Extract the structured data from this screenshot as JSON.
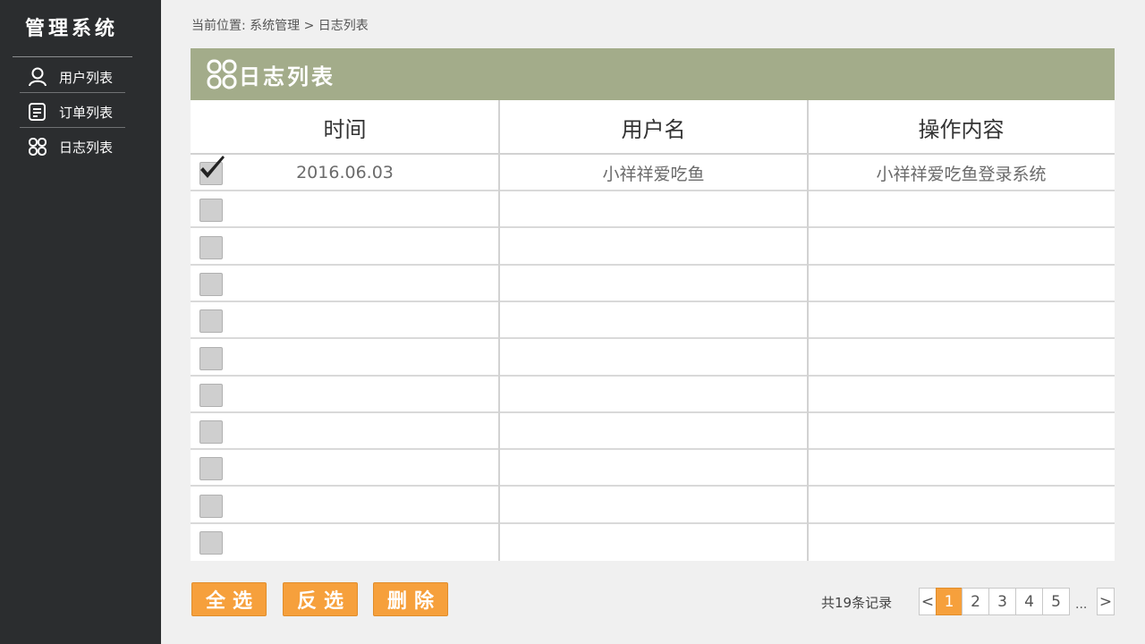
{
  "app": {
    "title": "管理系统"
  },
  "sidebar": {
    "items": [
      {
        "label": "用户列表",
        "icon": "user-icon"
      },
      {
        "label": "订单列表",
        "icon": "order-list-icon"
      },
      {
        "label": "日志列表",
        "icon": "grid-icon"
      }
    ]
  },
  "breadcrumb": {
    "text": "当前位置: 系统管理 > 日志列表"
  },
  "panel": {
    "title": "日志列表",
    "icon": "grid-icon"
  },
  "table": {
    "columns": [
      "时间",
      "用户名",
      "操作内容"
    ],
    "rows": [
      {
        "time": "2016.06.03",
        "user": "小祥祥爱吃鱼",
        "action": "小祥祥爱吃鱼登录系统",
        "checked": true
      },
      {
        "time": "",
        "user": "",
        "action": "",
        "checked": false
      },
      {
        "time": "",
        "user": "",
        "action": "",
        "checked": false
      },
      {
        "time": "",
        "user": "",
        "action": "",
        "checked": false
      },
      {
        "time": "",
        "user": "",
        "action": "",
        "checked": false
      },
      {
        "time": "",
        "user": "",
        "action": "",
        "checked": false
      },
      {
        "time": "",
        "user": "",
        "action": "",
        "checked": false
      },
      {
        "time": "",
        "user": "",
        "action": "",
        "checked": false
      },
      {
        "time": "",
        "user": "",
        "action": "",
        "checked": false
      },
      {
        "time": "",
        "user": "",
        "action": "",
        "checked": false
      },
      {
        "time": "",
        "user": "",
        "action": "",
        "checked": false
      }
    ]
  },
  "actions": {
    "select_all": "全选",
    "invert": "反选",
    "delete": "删除"
  },
  "pagination": {
    "total_text": "共19条记录",
    "prev": "<",
    "next": ">",
    "pages": [
      "1",
      "2",
      "3",
      "4",
      "5"
    ],
    "current": "1",
    "ellipsis": "..."
  },
  "colors": {
    "sidebar": "#2b2d2f",
    "header": "#a3ac8a",
    "accent": "#f6a03c"
  }
}
